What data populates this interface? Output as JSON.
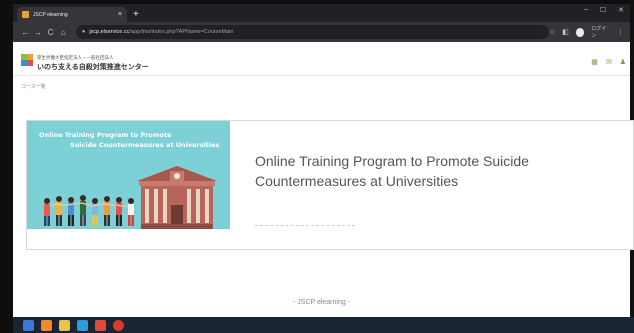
{
  "browser": {
    "tab_title": "JSCP elearning",
    "tab_close": "×",
    "new_tab": "+",
    "win_minimize": "–",
    "win_maximize": "☐",
    "win_close": "✕",
    "nav_back": "←",
    "nav_forward": "→",
    "nav_reload": "C",
    "nav_home": "⌂",
    "url_host": "jscp.elservice.cc",
    "url_path": "/app/lms/index.php?APName=CourseMain",
    "profile_label": "ログイン"
  },
  "site": {
    "org_line1": "厚生労働大臣指定法人・一般社団法人",
    "org_line2": "いのち支える自殺対策推進センター",
    "breadcrumb": "コース一覧",
    "footer": "- JSCP elearning -"
  },
  "course": {
    "banner_line1": "Online Training Program to Promote",
    "banner_line2": "Suicide Countermeasures at Universities",
    "title": "Online Training Program to Promote Suicide Countermeasures at Universities"
  },
  "colors": {
    "banner_bg": "#7dd1d6",
    "building": "#b8645a",
    "logo_green": "#8cbf3f",
    "logo_orange": "#f0a030",
    "logo_blue": "#3a8fd6",
    "logo_red": "#e05050"
  }
}
